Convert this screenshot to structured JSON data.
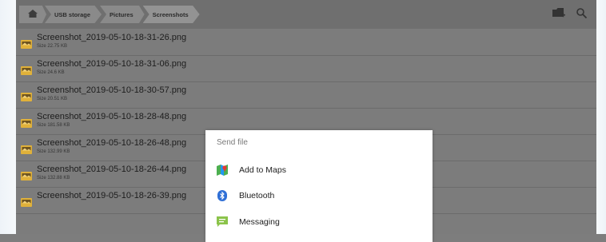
{
  "breadcrumb": {
    "home_icon": "home-icon",
    "items": [
      "USB storage",
      "Pictures",
      "Screenshots"
    ]
  },
  "toolbar": {
    "icons": [
      "new-folder-icon",
      "search-icon"
    ]
  },
  "files": [
    {
      "name": "Screenshot_2019-05-10-18-31-26.png",
      "size": "Size 22.75 KB"
    },
    {
      "name": "Screenshot_2019-05-10-18-31-06.png",
      "size": "Size 24.6 KB"
    },
    {
      "name": "Screenshot_2019-05-10-18-30-57.png",
      "size": "Size 20.51 KB"
    },
    {
      "name": "Screenshot_2019-05-10-18-28-48.png",
      "size": "Size 181.58 KB"
    },
    {
      "name": "Screenshot_2019-05-10-18-26-48.png",
      "size": "Size 132.99 KB"
    },
    {
      "name": "Screenshot_2019-05-10-18-26-44.png",
      "size": "Size 132.88 KB"
    },
    {
      "name": "Screenshot_2019-05-10-18-26-39.png",
      "size": ""
    }
  ],
  "dialog": {
    "title": "Send file",
    "options": [
      {
        "label": "Add to Maps",
        "icon": "maps-icon"
      },
      {
        "label": "Bluetooth",
        "icon": "bluetooth-icon"
      },
      {
        "label": "Messaging",
        "icon": "messaging-icon"
      }
    ]
  },
  "colors": {
    "background_dim": "#7c7c7c",
    "file_icon": "#e0b13a",
    "dialog_bg": "#ffffff",
    "bluetooth": "#2f6fd6",
    "messaging": "#8bc34a"
  }
}
